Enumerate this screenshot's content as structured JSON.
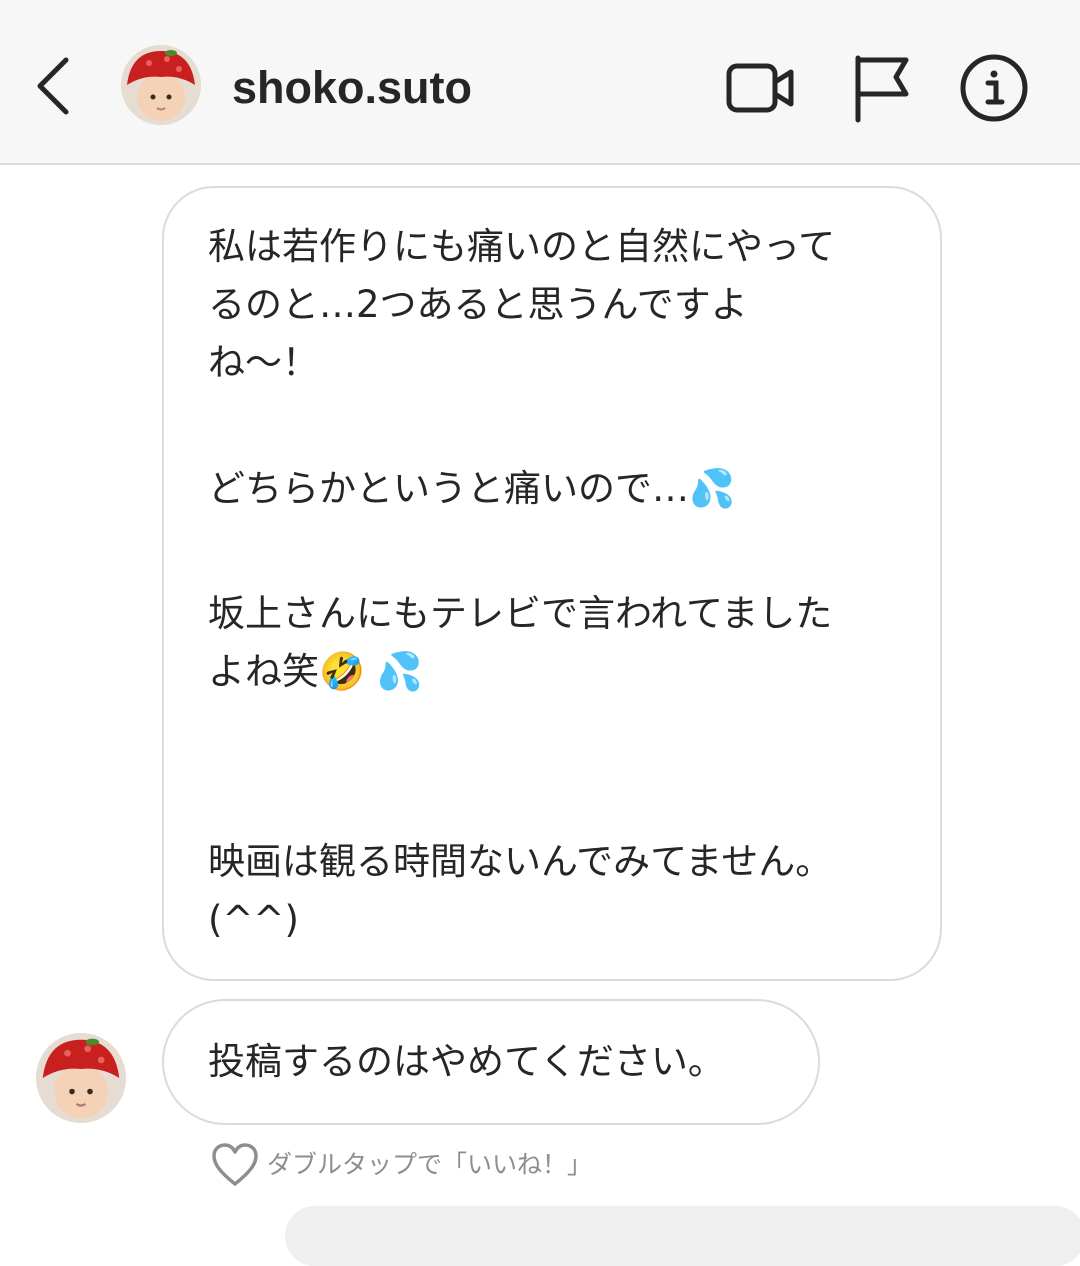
{
  "header": {
    "username": "shoko.suto",
    "back_icon": "chevron-left-icon",
    "video_icon": "video-camera-icon",
    "flag_icon": "flag-icon",
    "info_icon": "info-icon"
  },
  "messages": [
    {
      "paragraphs": [
        "私は若作りにも痛いのと自然にやって\nるのと…2つあると思うんですよ\nね〜！",
        "どちらかというと痛いので…💦",
        "坂上さんにもテレビで言われてました\nよね笑🤣 💦",
        "映画は観る時間ないんでみてません。\n(^^)"
      ]
    },
    {
      "text": "投稿するのはやめてください。",
      "like_hint": "ダブルタップで「いいね！」",
      "like_icon": "heart-outline-icon"
    }
  ],
  "colors": {
    "header_bg": "#f7f7f7",
    "bubble_border": "#dbdbdb",
    "text": "#262626",
    "hint_text": "#8e8e8e",
    "avatar_hat_red": "#c8201e"
  }
}
